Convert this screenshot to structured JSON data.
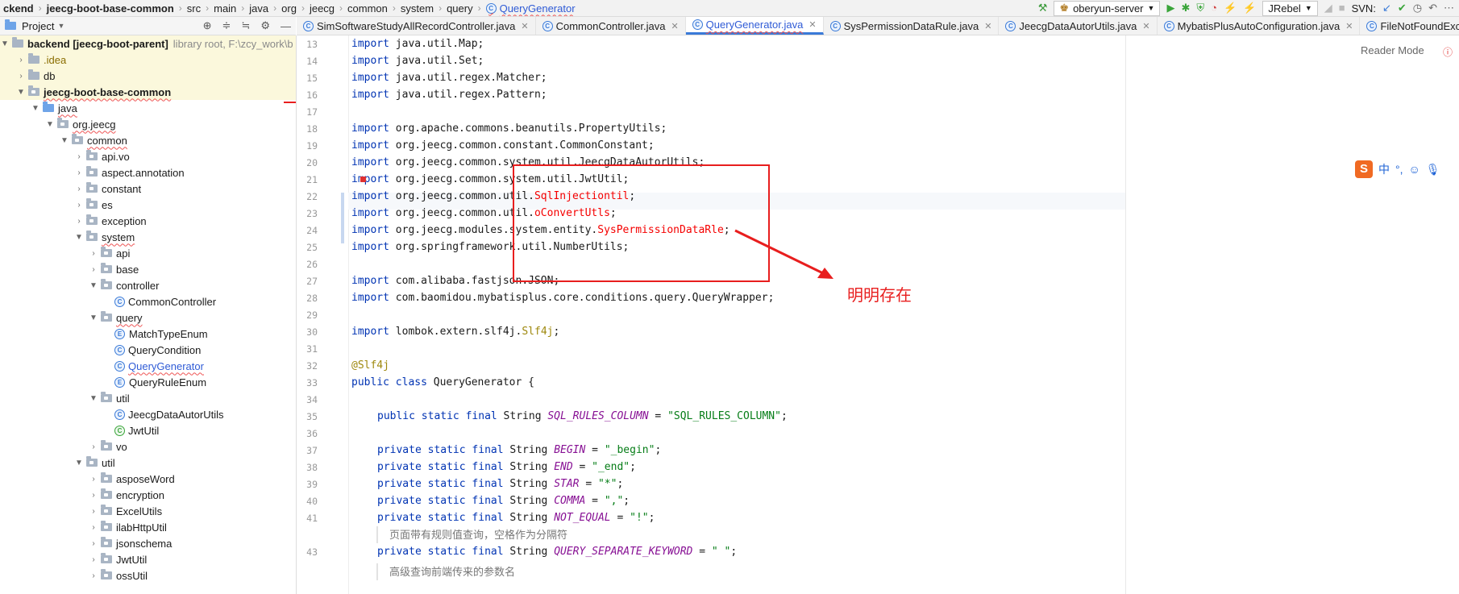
{
  "breadcrumb": [
    "ckend",
    "jeecg-boot-base-common",
    "src",
    "main",
    "java",
    "org",
    "jeecg",
    "common",
    "system",
    "query",
    "QueryGenerator"
  ],
  "toolbar": {
    "run_config": "oberyun-server",
    "jrebel": "JRebel",
    "svn": "SVN:"
  },
  "project_panel": {
    "title": "Project",
    "root_label": "backend [jeecg-boot-parent]",
    "root_hint": "library root, F:\\zcy_work\\b",
    "items": [
      {
        "label": "idea",
        "text": ".idea"
      },
      {
        "text": "db"
      },
      {
        "text": "jeecg-boot-base-common"
      },
      {
        "text": "java"
      },
      {
        "text": "org.jeecg"
      },
      {
        "text": "common"
      },
      {
        "text": "api.vo"
      },
      {
        "text": "aspect.annotation"
      },
      {
        "text": "constant"
      },
      {
        "text": "es"
      },
      {
        "text": "exception"
      },
      {
        "text": "system"
      },
      {
        "text": "api"
      },
      {
        "text": "base"
      },
      {
        "text": "controller"
      },
      {
        "text": "CommonController"
      },
      {
        "text": "query"
      },
      {
        "text": "MatchTypeEnum"
      },
      {
        "text": "QueryCondition"
      },
      {
        "text": "QueryGenerator"
      },
      {
        "text": "QueryRuleEnum"
      },
      {
        "text": "util"
      },
      {
        "text": "JeecgDataAutorUtils"
      },
      {
        "text": "JwtUtil"
      },
      {
        "text": "vo"
      },
      {
        "text": "util"
      },
      {
        "text": "asposeWord"
      },
      {
        "text": "encryption"
      },
      {
        "text": "ExcelUtils"
      },
      {
        "text": "ilabHttpUtil"
      },
      {
        "text": "jsonschema"
      },
      {
        "text": "JwtUtil"
      },
      {
        "text": "ossUtil"
      }
    ]
  },
  "tabs": [
    {
      "label": "SimSoftwareStudyAllRecordController.java"
    },
    {
      "label": "CommonController.java"
    },
    {
      "label": "QueryGenerator.java"
    },
    {
      "label": "SysPermissionDataRule.java"
    },
    {
      "label": "JeecgDataAutorUtils.java"
    },
    {
      "label": "MybatisPlusAutoConfiguration.java"
    },
    {
      "label": "FileNotFoundExcep"
    }
  ],
  "editor": {
    "reader_mode": "Reader Mode",
    "line_numbers": [
      "13",
      "14",
      "15",
      "16",
      "17",
      "18",
      "19",
      "20",
      "21",
      "22",
      "23",
      "24",
      "25",
      "26",
      "27",
      "28",
      "29",
      "30",
      "31",
      "32",
      "33",
      "34",
      "35",
      "36",
      "37",
      "38",
      "39",
      "40",
      "41",
      "43"
    ],
    "lines": [
      "import java.util.Map;",
      "import java.util.Set;",
      "import java.util.regex.Matcher;",
      "import java.util.regex.Pattern;",
      "",
      "import org.apache.commons.beanutils.PropertyUtils;",
      "import org.jeecg.common.constant.CommonConstant;",
      "import org.jeecg.common.system.util.JeecgDataAutorUtils;",
      "import org.jeecg.common.system.util.JwtUtil;",
      "import org.jeecg.common.util.",
      "import org.jeecg.common.util.",
      "import org.jeecg.modules.system.entity.",
      "import org.springframework.util.NumberUtils;",
      "",
      "import com.alibaba.fastjson.JSON;",
      "import com.baomidou.mybatisplus.core.conditions.query.QueryWrapper;",
      "",
      "import lombok.extern.slf4j.",
      "",
      "@Slf4j",
      "public class QueryGenerator {",
      "",
      "public static final String ",
      "",
      "private static final String ",
      "private static final String ",
      "private static final String ",
      "private static final String ",
      "private static final String ",
      "private static final String "
    ],
    "err_tokens": [
      "SqlInjectiontil",
      "oConvertUtls",
      "SysPermissionDataRle"
    ],
    "slf4j": "Slf4j",
    "constants": [
      {
        "name": "SQL_RULES_COLUMN",
        "value": "\"SQL_RULES_COLUMN\""
      },
      {
        "name": "BEGIN",
        "value": "\"_begin\""
      },
      {
        "name": "END",
        "value": "\"_end\""
      },
      {
        "name": "STAR",
        "value": "\"*\""
      },
      {
        "name": "COMMA",
        "value": "\",\""
      },
      {
        "name": "NOT_EQUAL",
        "value": "\"!\""
      },
      {
        "name": "QUERY_SEPARATE_KEYWORD",
        "value": "\" \""
      }
    ],
    "hint1": "页面带有规则值查询，空格作为分隔符",
    "hint2": "高级查询前端传来的参数名"
  },
  "annotation": {
    "text": "明明存在",
    "color": "#e81e1e"
  },
  "ime": {
    "logo": "S",
    "mode": "中"
  }
}
